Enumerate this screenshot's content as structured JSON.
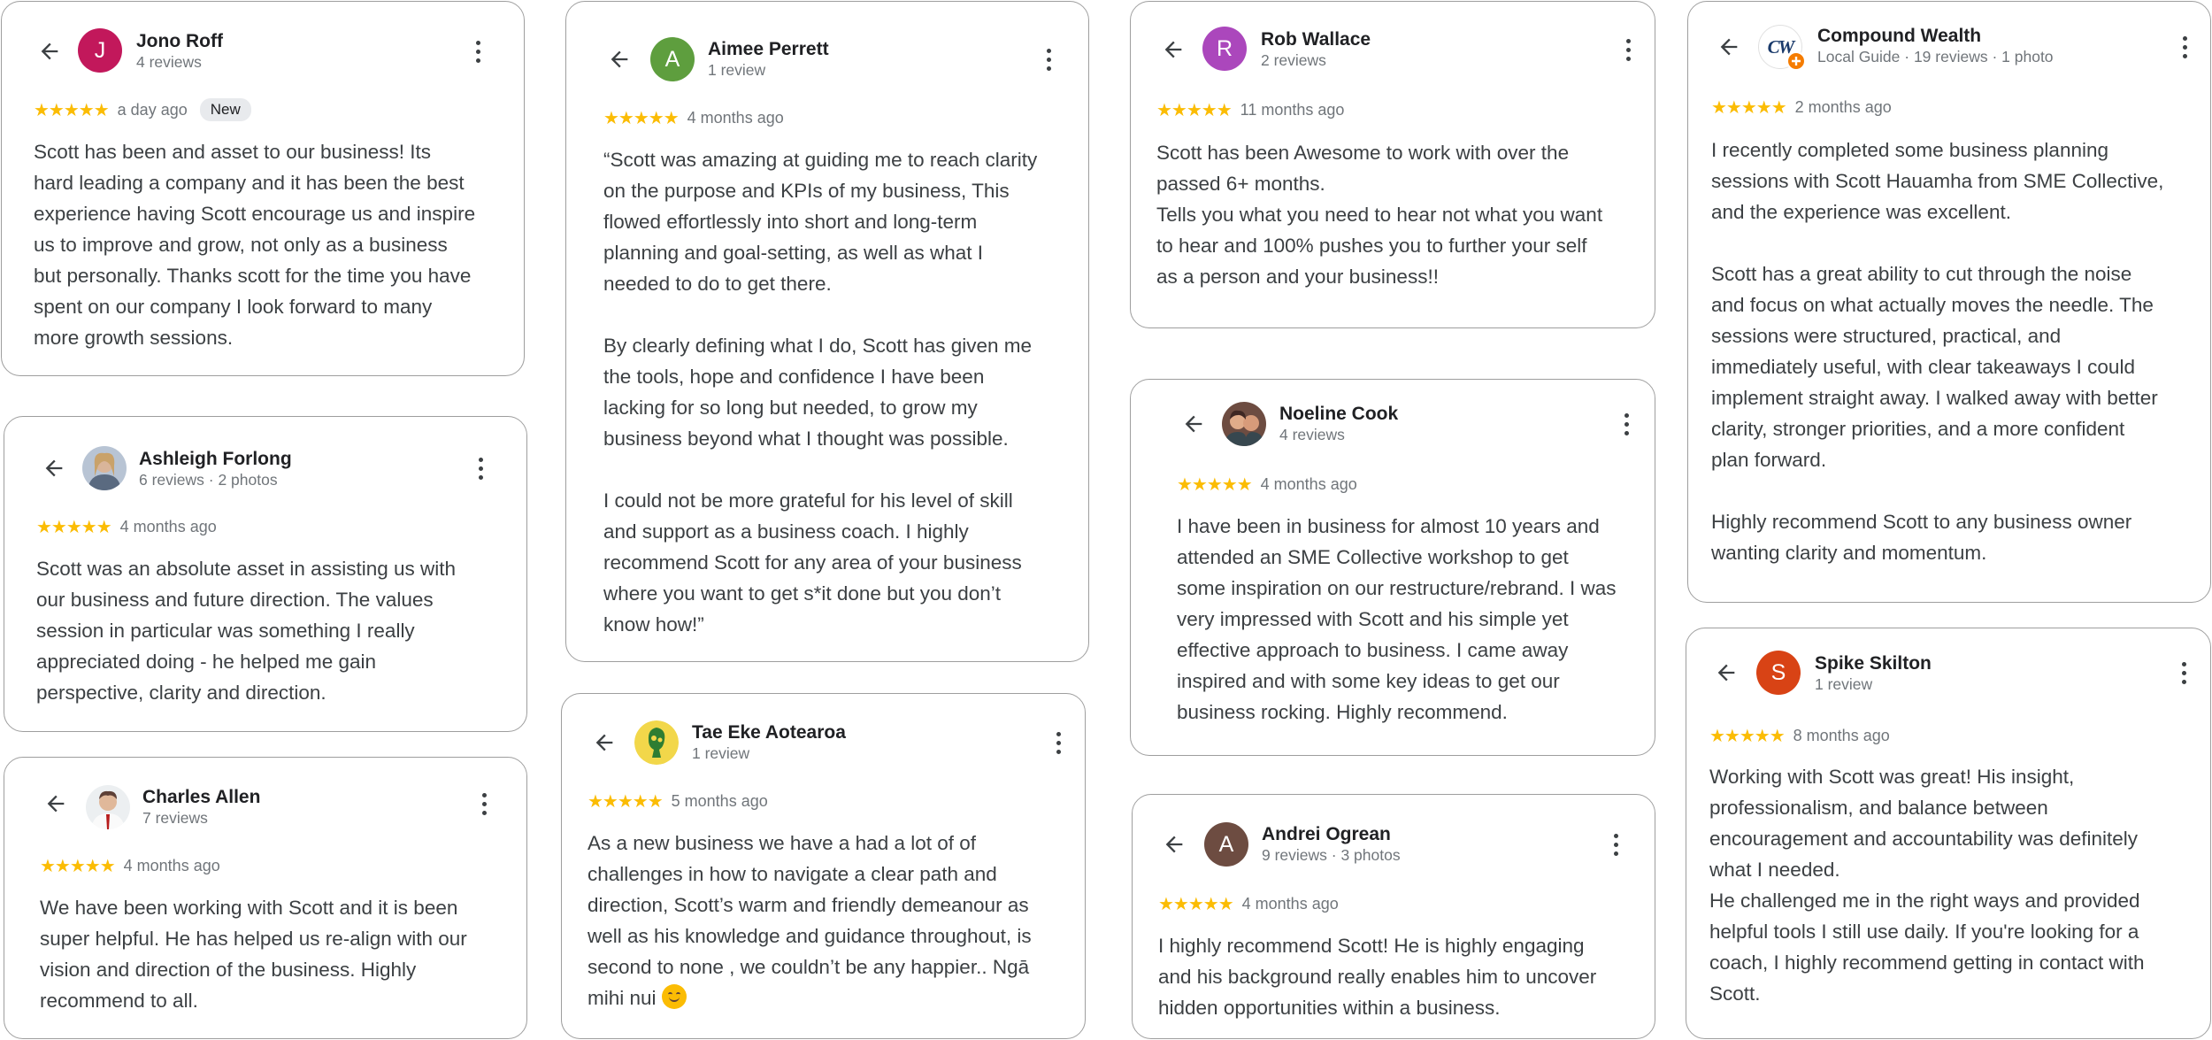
{
  "reviews": [
    {
      "name": "Jono Roff",
      "meta": "4 reviews",
      "initial": "J",
      "avatar_color": "#c2185b",
      "stars": "★★★★★",
      "time": "a day ago",
      "badge": "New",
      "text": "Scott has been and asset to our business! Its\nhard leading a company and it has been the best\nexperience having Scott encourage us and inspire\nus to improve and grow, not only as a business\nbut personally. Thanks scott for the time you have\nspent on our company I look forward to many\nmore growth sessions."
    },
    {
      "name": "Ashleigh Forlong",
      "meta": "6 reviews · 2 photos",
      "stars": "★★★★★",
      "time": "4 months ago",
      "text": "Scott was an absolute asset in assisting us with\nour business and future direction. The values\nsession in particular was something I really\nappreciated doing - he helped me gain\nperspective, clarity and direction."
    },
    {
      "name": "Charles Allen",
      "meta": "7 reviews",
      "stars": "★★★★★",
      "time": "4 months ago",
      "text": "We have been working with Scott and it is been\nsuper helpful. He has helped us re-align with our\nvision and direction of the business. Highly\nrecommend to all."
    },
    {
      "name": "Aimee Perrett",
      "meta": "1 review",
      "initial": "A",
      "avatar_color": "#5e9e3e",
      "stars": "★★★★★",
      "time": "4 months ago",
      "text": "“Scott was amazing at guiding me to reach clarity\non the purpose and KPIs of my business, This\nflowed effortlessly into short and long-term\nplanning and goal-setting, as well as what I\nneeded to do to get there.\n\nBy clearly defining what I do, Scott has given me\nthe tools, hope and confidence I have been\nlacking for so long but needed, to grow my\nbusiness beyond what I thought was possible.\n\nI could not be more grateful for his level of skill\nand support as a business coach. I highly\nrecommend Scott for any area of your business\nwhere you want to get s*it done but you don’t\nknow how!”"
    },
    {
      "name": "Tae Eke Aotearoa",
      "meta": "1 review",
      "stars": "★★★★★",
      "time": "5 months ago",
      "text": "As a new business we have a had a lot of of\nchallenges in how to navigate a clear path and\ndirection, Scott’s warm and friendly demeanour as\nwell as his knowledge and guidance throughout, is\nsecond to none , we couldn’t be any happier.. Ngā\nmihi nui"
    },
    {
      "name": "Rob Wallace",
      "meta": "2 reviews",
      "initial": "R",
      "avatar_color": "#ab47bc",
      "stars": "★★★★★",
      "time": "11 months ago",
      "text": "Scott has been Awesome to work with over the\npassed 6+ months.\nTells you what you need to hear not what you want\nto hear and 100% pushes you to further your self\nas a person and your business!!"
    },
    {
      "name": "Noeline Cook",
      "meta": "4 reviews",
      "stars": "★★★★★",
      "time": "4 months ago",
      "text": "I have been in business for almost 10 years and\nattended an SME Collective workshop to get\nsome inspiration on our restructure/rebrand. I was\nvery impressed with Scott and his simple yet\neffective approach to business. I came away\ninspired and with some key ideas to get our\nbusiness rocking. Highly recommend."
    },
    {
      "name": "Andrei Ogrean",
      "meta": "9 reviews · 3 photos",
      "initial": "A",
      "avatar_color": "#6d4c41",
      "stars": "★★★★★",
      "time": "4 months ago",
      "text": "I highly recommend Scott! He is highly engaging\nand his background really enables him to uncover\nhidden opportunities within a business."
    },
    {
      "name": "Compound Wealth",
      "meta": "Local Guide · 19 reviews · 1 photo",
      "logo": "CW",
      "stars": "★★★★★",
      "time": "2 months ago",
      "text": "I recently completed some business planning\nsessions with Scott Hauamha from SME Collective,\nand the experience was excellent.\n\nScott has a great ability to cut through the noise\nand focus on what actually moves the needle. The\nsessions were structured, practical, and\nimmediately useful, with clear takeaways I could\nimplement straight away. I walked away with better\nclarity, stronger priorities, and a more confident\nplan forward.\n\nHighly recommend Scott to any business owner\nwanting clarity and momentum."
    },
    {
      "name": "Spike Skilton",
      "meta": "1 review",
      "initial": "S",
      "avatar_color": "#d84315",
      "stars": "★★★★★",
      "time": "8 months ago",
      "text": "Working with Scott was great! His insight,\nprofessionalism, and balance between\nencouragement and accountability was definitely\nwhat I needed.\nHe challenged me in the right ways and provided\nhelpful tools I still use daily. If you're looking for a\ncoach, I highly recommend getting in contact with\nScott."
    }
  ]
}
